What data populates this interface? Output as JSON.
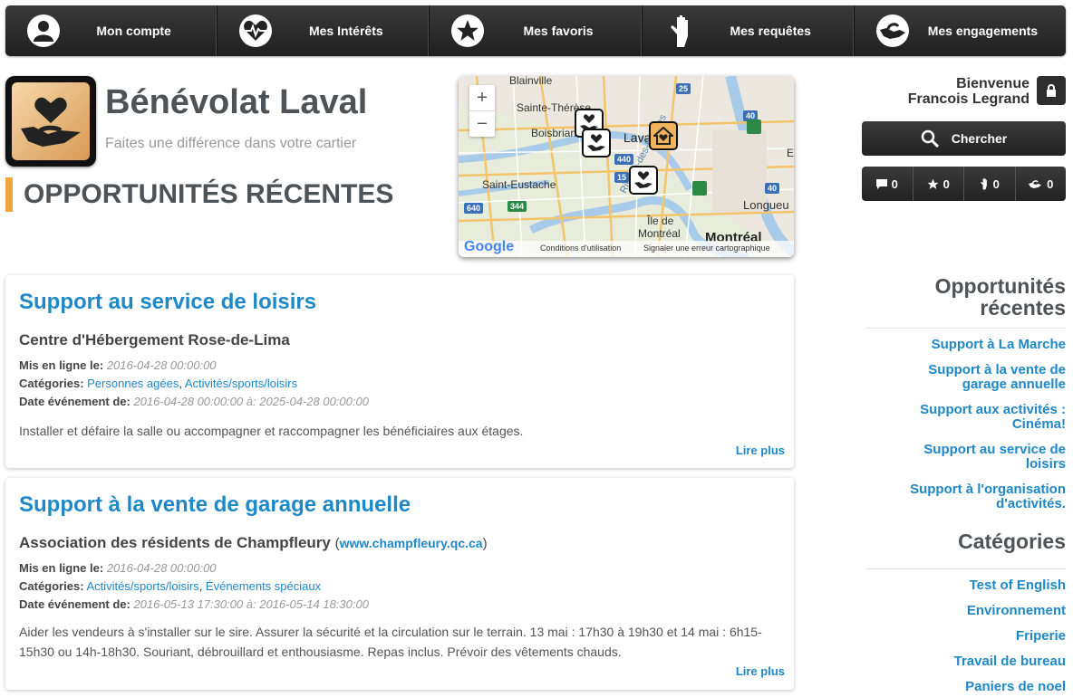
{
  "nav": [
    {
      "label": "Mon compte",
      "icon": "user-icon"
    },
    {
      "label": "Mes Intérêts",
      "icon": "heart-pulse-icon"
    },
    {
      "label": "Mes favoris",
      "icon": "star-icon"
    },
    {
      "label": "Mes requêtes",
      "icon": "raised-hand-icon"
    },
    {
      "label": "Mes engagements",
      "icon": "helping-hand-icon"
    }
  ],
  "site": {
    "title": "Bénévolat Laval",
    "tagline": "Faites une différence dans votre cartier",
    "section_title": "OPPORTUNITÉS RÉCENTES"
  },
  "map": {
    "zoom_in": "+",
    "zoom_out": "−",
    "labels": {
      "blainville": "Blainville",
      "sainte_therese": "Sainte-Thérèse",
      "boisbriand": "Boisbriand",
      "laval": "Laval",
      "saint_eustache": "Saint-Eustache",
      "riviere": "Rivière-des-Prairies",
      "ile_de_montreal": "Île de",
      "ile_de_montreal_2": "Montréal",
      "montreal": "Montréal",
      "longueuil": "Longueu",
      "e": "E"
    },
    "shields": [
      "25",
      "40",
      "440",
      "15",
      "344",
      "640",
      "40"
    ],
    "google": "Google",
    "terms": "Conditions d'utilisation",
    "report": "Signaler une erreur cartographique"
  },
  "user": {
    "welcome": "Bienvenue",
    "name": "Francois Legrand"
  },
  "search_label": "Chercher",
  "counters": [
    {
      "icon": "comment-icon",
      "value": "0"
    },
    {
      "icon": "star-icon",
      "value": "0"
    },
    {
      "icon": "hand-icon",
      "value": "0"
    },
    {
      "icon": "handshake-icon",
      "value": "0"
    }
  ],
  "cards": [
    {
      "title": "Support au service de loisirs",
      "org": "Centre d'Hébergement Rose-de-Lima",
      "posted_label": "Mis en ligne le:",
      "posted": "2016-04-28 00:00:00",
      "categories_label": "Catégories:",
      "categories": [
        "Personnes agées",
        "Activités/sports/loisirs"
      ],
      "event_label": "Date événement de:",
      "event": "2016-04-28 00:00:00 à: 2025-04-28 00:00:00",
      "description": "Installer et défaire la salle ou accompagner et raccompagner les bénéficiaires aux étages.",
      "more": "Lire plus"
    },
    {
      "title": "Support à la vente de garage annuelle",
      "org": "Association des résidents de Champfleury",
      "org_link": "www.champfleury.qc.ca",
      "posted_label": "Mis en ligne le:",
      "posted": "2016-04-28 00:00:00",
      "categories_label": "Catégories:",
      "categories": [
        "Activités/sports/loisirs",
        "Événements spéciaux"
      ],
      "event_label": "Date événement de:",
      "event": "2016-05-13 17:30:00 à: 2016-05-14 18:30:00",
      "description": "Aider les vendeurs à s'installer sur le sire. Assurer la sécurité et la circulation sur le terrain. 13 mai : 17h30 à 19h30 et 14 mai : 6h15-15h30 ou 14h-18h30. Souriant, débrouillard et enthousiasme. Repas inclus. Prévoir des vêtements chauds.",
      "more": "Lire plus"
    }
  ],
  "sidebar": {
    "recent_heading_1": "Opportunités",
    "recent_heading_2": "récentes",
    "recent": [
      {
        "line1": "Support à La Marche",
        "line2": ""
      },
      {
        "line1": "Support à la vente de",
        "line2": "garage annuelle"
      },
      {
        "line1": "Support aux activités :",
        "line2": "Cinéma!"
      },
      {
        "line1": "Support au service de",
        "line2": "loisirs"
      },
      {
        "line1": "Support à l'organisation",
        "line2": "d'activités."
      }
    ],
    "categories_heading": "Catégories",
    "categories": [
      "Test of English",
      "Environnement",
      "Friperie",
      "Travail de bureau",
      "Paniers de noel"
    ]
  }
}
